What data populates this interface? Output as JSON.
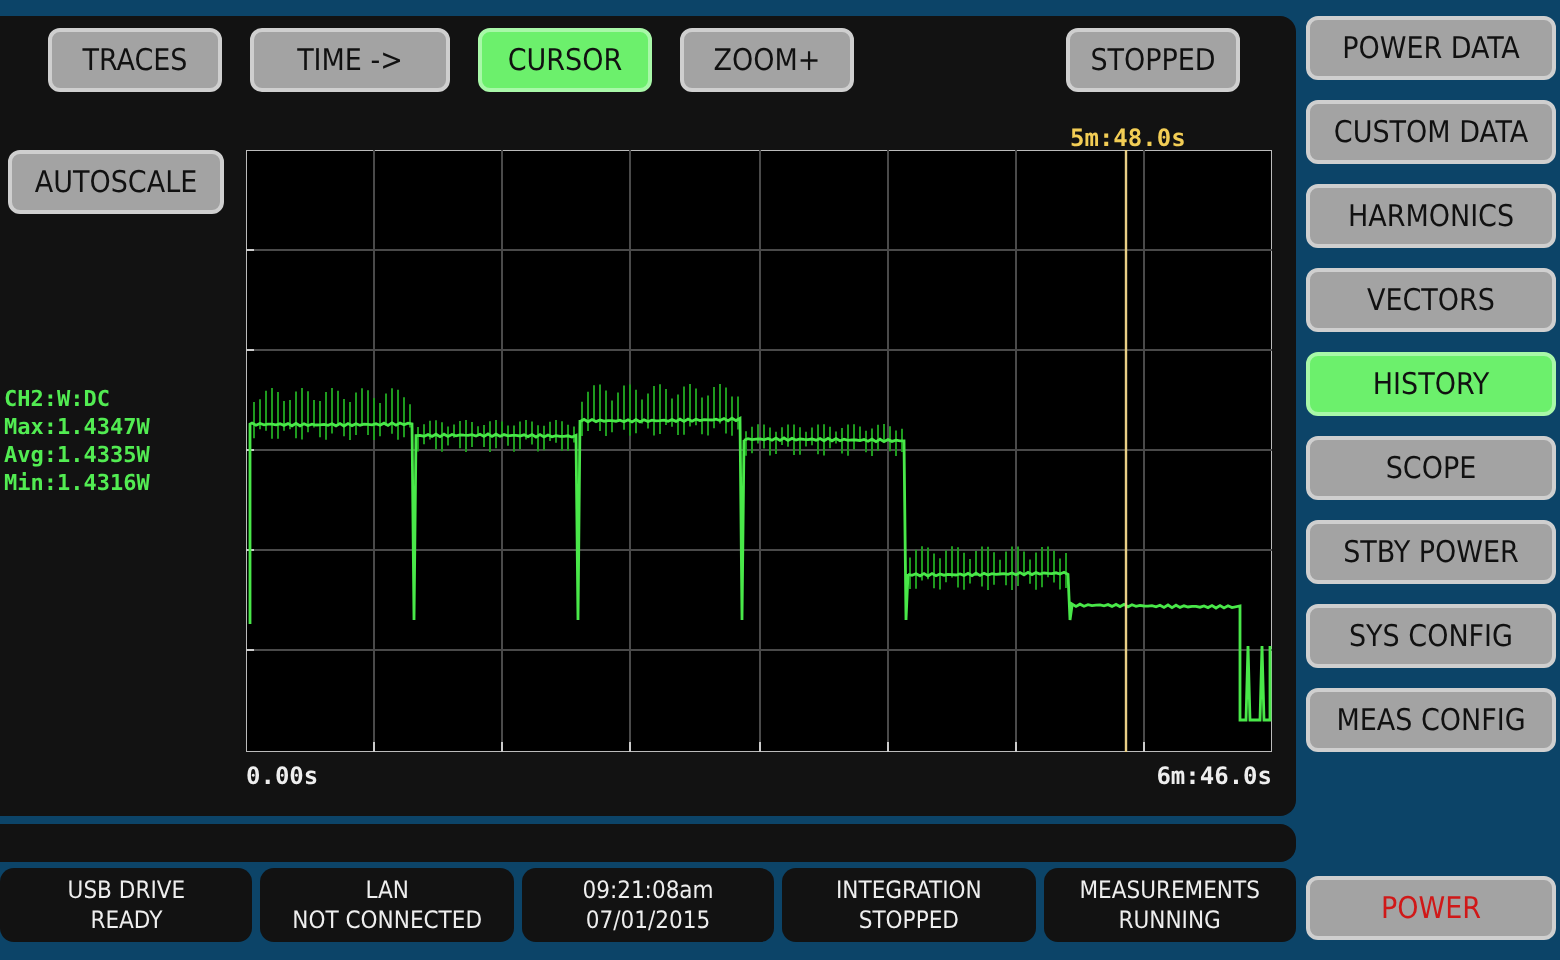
{
  "toolbar": {
    "buttons": [
      {
        "label": "TRACES",
        "selected": false
      },
      {
        "label": "TIME ->",
        "selected": false
      },
      {
        "label": "CURSOR",
        "selected": true
      },
      {
        "label": "ZOOM+",
        "selected": false
      }
    ],
    "run_state": "STOPPED"
  },
  "autoscale_button": "AUTOSCALE",
  "cursor_readout": "5m:48.0s",
  "trace_info": [
    "CH2:W:DC",
    "Max:1.4347W",
    "Avg:1.4335W",
    "Min:1.4316W"
  ],
  "x_axis": {
    "start": "0.00s",
    "end": "6m:46.0s"
  },
  "status_bar": [
    {
      "label": "USB DRIVE",
      "value": "READY"
    },
    {
      "label": "LAN",
      "value": "NOT CONNECTED"
    },
    {
      "label": "09:21:08am",
      "value": "07/01/2015"
    },
    {
      "label": "INTEGRATION",
      "value": "STOPPED"
    },
    {
      "label": "MEASUREMENTS",
      "value": "RUNNING"
    }
  ],
  "menu": {
    "items": [
      {
        "label": "POWER DATA",
        "selected": false
      },
      {
        "label": "CUSTOM DATA",
        "selected": false
      },
      {
        "label": "HARMONICS",
        "selected": false
      },
      {
        "label": "VECTORS",
        "selected": false
      },
      {
        "label": "HISTORY",
        "selected": true
      },
      {
        "label": "SCOPE",
        "selected": false
      },
      {
        "label": "STBY POWER",
        "selected": false
      },
      {
        "label": "SYS CONFIG",
        "selected": false
      },
      {
        "label": "MEAS CONFIG",
        "selected": false
      }
    ],
    "power_button": "POWER"
  }
}
